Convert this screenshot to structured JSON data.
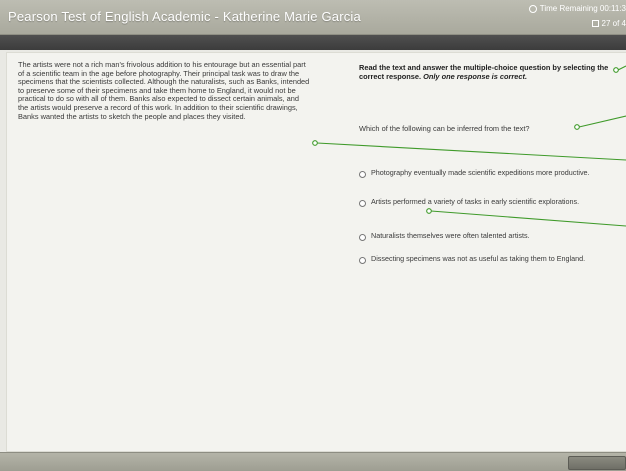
{
  "window": {
    "title": "Pearson Test of English Academic - Katherine Marie Garcia",
    "time_remaining": "Time Remaining 00:11:3",
    "item_counter": "27 of 4"
  },
  "passage": {
    "text": "The artists were not a rich man's frivolous addition to his entourage but an essential part of a scientific team in the age before photography. Their principal task was to draw the specimens that the scientists collected. Although the naturalists, such as Banks, intended to preserve some of their specimens and take them home to England, it would not be practical to do so with all of them. Banks also expected to dissect certain animals, and the artists would preserve a record of this work. In addition to their scientific drawings, Banks wanted the artists to sketch the people and places they visited."
  },
  "instruction": {
    "part1": "Read the text and answer the multiple-choice question by selecting the correct response. ",
    "part2": "Only one response is correct."
  },
  "question": {
    "text": "Which of the following can be inferred from the text?"
  },
  "options": [
    {
      "label": "Photography eventually made scientific expeditions more productive."
    },
    {
      "label": "Artists performed a variety of tasks in early scientific explorations."
    },
    {
      "label": "Naturalists themselves were often talented artists."
    },
    {
      "label": "Dissecting specimens was not as useful as taking them to England."
    }
  ],
  "colors": {
    "annotation_line": "#3f9a2a",
    "title_bar": "#b3b3a8",
    "sub_bar": "#454545",
    "content_bg": "#f3f3ef"
  },
  "icons": {
    "timer": "clock-icon",
    "counter": "page-icon"
  }
}
